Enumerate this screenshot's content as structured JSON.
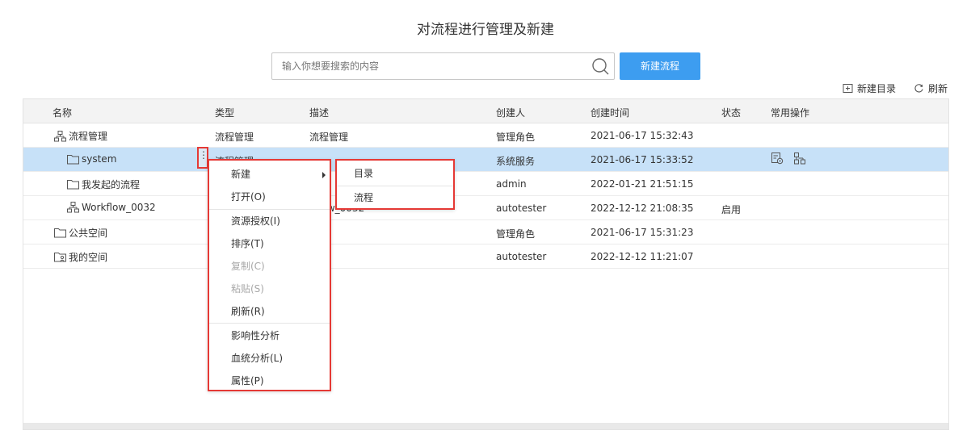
{
  "page_title": "对流程进行管理及新建",
  "search": {
    "placeholder": "输入你想要搜索的内容"
  },
  "new_flow_label": "新建流程",
  "toolbar": {
    "new_dir": "新建目录",
    "refresh": "刷新"
  },
  "columns": {
    "name": "名称",
    "type": "类型",
    "desc": "描述",
    "creator": "创建人",
    "created": "创建时间",
    "status": "状态",
    "ops": "常用操作"
  },
  "rows": [
    {
      "name": "流程管理",
      "icon": "workflow-icon",
      "type": "流程管理",
      "desc": "流程管理",
      "creator": "管理角色",
      "created": "2021-06-17 15:32:43",
      "status": ""
    },
    {
      "name": "system",
      "icon": "folder-icon",
      "type": "流程管理",
      "desc": "",
      "creator": "系统服务",
      "created": "2021-06-17 15:33:52",
      "status": ""
    },
    {
      "name": "我发起的流程",
      "icon": "folder-icon",
      "type": "",
      "desc": "",
      "creator": "admin",
      "created": "2022-01-21 21:51:15",
      "status": ""
    },
    {
      "name": "Workflow_0032",
      "icon": "workflow-icon",
      "type": "",
      "desc": "kflow_0032",
      "creator": "autotester",
      "created": "2022-12-12 21:08:35",
      "status": "启用"
    },
    {
      "name": "公共空间",
      "icon": "folder-icon",
      "type": "",
      "desc": "空间",
      "creator": "管理角色",
      "created": "2021-06-17 15:31:23",
      "status": ""
    },
    {
      "name": "我的空间",
      "icon": "user-folder-icon",
      "type": "",
      "desc": "空间",
      "creator": "autotester",
      "created": "2022-12-12 11:21:07",
      "status": ""
    }
  ],
  "row_menu_trigger": "⋮",
  "context_menu": [
    {
      "label": "新建"
    },
    {
      "label": "打开(O)"
    },
    {
      "label": "资源授权(I)"
    },
    {
      "label": "排序(T)"
    },
    {
      "label": "复制(C)"
    },
    {
      "label": "粘贴(S)"
    },
    {
      "label": "刷新(R)"
    },
    {
      "label": "影响性分析"
    },
    {
      "label": "血统分析(L)"
    },
    {
      "label": "属性(P)"
    }
  ],
  "submenu": [
    {
      "label": "目录"
    },
    {
      "label": "流程"
    }
  ],
  "colors": {
    "accent": "#3d9df0",
    "selected_row": "#c7e1f8",
    "highlight_border": "#e53935"
  }
}
